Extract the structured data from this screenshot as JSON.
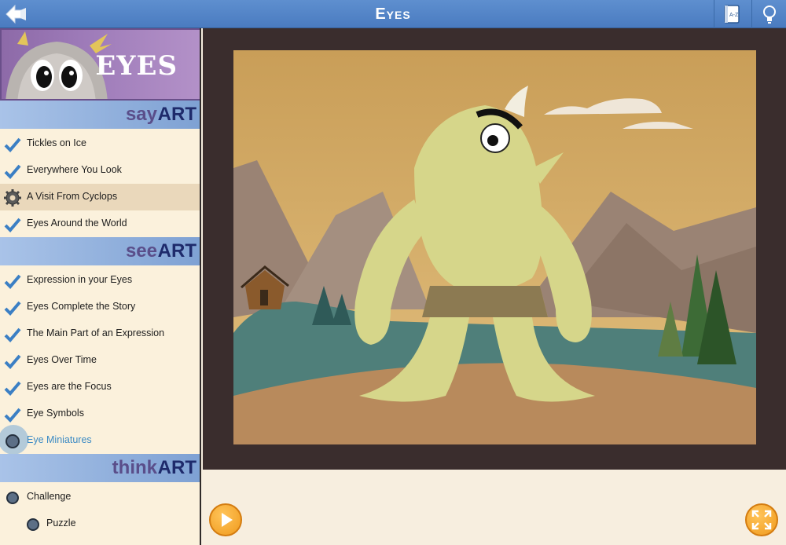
{
  "topbar": {
    "title": "Eyes",
    "icons": [
      "back-arrow-icon",
      "glossary-book-icon",
      "lightbulb-icon"
    ]
  },
  "sidebar": {
    "header_title": "EYES",
    "sections": [
      {
        "prefix": "say",
        "suffix": "ART",
        "items": [
          {
            "label": "Tickles on Ice",
            "status": "complete"
          },
          {
            "label": "Everywhere You Look",
            "status": "complete"
          },
          {
            "label": "A Visit From Cyclops",
            "status": "active"
          },
          {
            "label": "Eyes Around the World",
            "status": "complete"
          }
        ]
      },
      {
        "prefix": "see",
        "suffix": "ART",
        "items": [
          {
            "label": "Expression in your Eyes",
            "status": "complete"
          },
          {
            "label": "Eyes Complete the Story",
            "status": "complete"
          },
          {
            "label": "The Main Part of an Expression",
            "status": "complete"
          },
          {
            "label": "Eyes Over Time",
            "status": "complete"
          },
          {
            "label": "Eyes are the Focus",
            "status": "complete"
          },
          {
            "label": "Eye Symbols",
            "status": "complete"
          },
          {
            "label": "Eye Miniatures",
            "status": "current"
          }
        ]
      },
      {
        "prefix": "think",
        "suffix": "ART",
        "items": [
          {
            "label": "Challenge",
            "status": "incomplete"
          },
          {
            "label": "Puzzle",
            "status": "incomplete"
          }
        ]
      }
    ]
  },
  "player": {
    "play_icon": "play-icon",
    "fullscreen_icon": "expand-icon"
  },
  "colors": {
    "topbar": "#5e8fcf",
    "section_header": "#a9c3e8",
    "check": "#3b7fc4",
    "accent_orange": "#f09a1c"
  }
}
